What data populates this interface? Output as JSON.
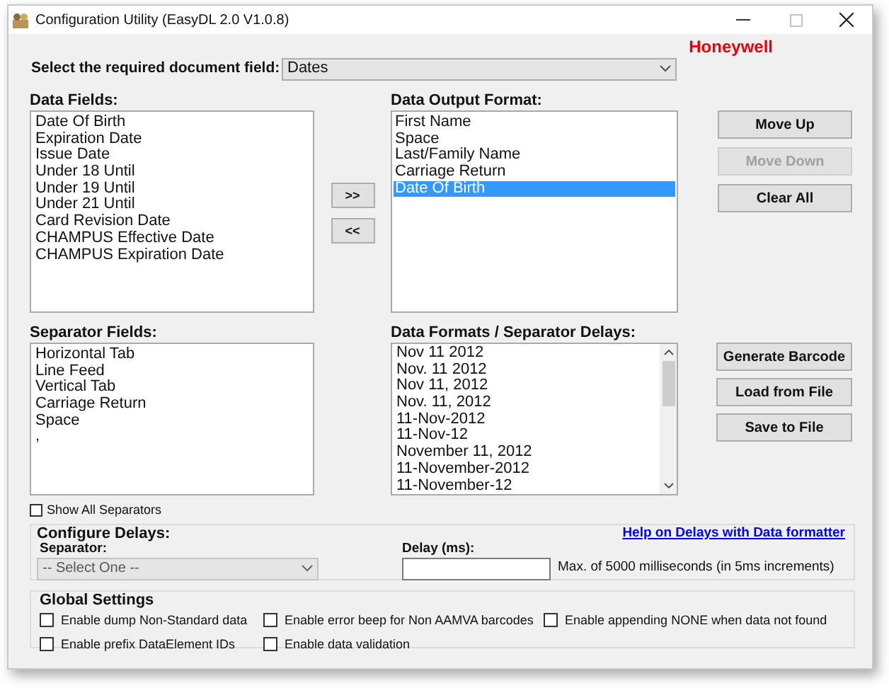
{
  "window": {
    "title": "Configuration Utility (EasyDL 2.0 V1.0.8)"
  },
  "brand": "Honeywell",
  "document_field": {
    "label": "Select the required document field:",
    "value": "Dates"
  },
  "data_fields": {
    "label": "Data Fields:",
    "items": [
      {
        "text": "Date Of Birth",
        "selected": false
      },
      {
        "text": "Expiration Date",
        "selected": false
      },
      {
        "text": "Issue Date",
        "selected": false
      },
      {
        "text": "Under 18 Until",
        "selected": false
      },
      {
        "text": "Under 19 Until",
        "selected": false
      },
      {
        "text": "Under 21 Until",
        "selected": false
      },
      {
        "text": "Card Revision Date",
        "selected": false
      },
      {
        "text": "CHAMPUS Effective Date",
        "selected": false
      },
      {
        "text": "CHAMPUS Expiration Date",
        "selected": false
      }
    ]
  },
  "transfer_buttons": [
    {
      "label": ">>"
    },
    {
      "label": "<<"
    }
  ],
  "data_output_format": {
    "label": "Data Output Format:",
    "items": [
      {
        "text": "First Name",
        "selected": false
      },
      {
        "text": "Space",
        "selected": false
      },
      {
        "text": "Last/Family Name",
        "selected": false
      },
      {
        "text": "Carriage Return",
        "selected": false
      },
      {
        "text": "Date Of Birth",
        "selected": true
      }
    ]
  },
  "order_buttons": [
    {
      "label": "Move Up",
      "disabled": false
    },
    {
      "label": "Move Down",
      "disabled": true
    },
    {
      "label": "Clear All",
      "disabled": false
    }
  ],
  "separator_fields": {
    "label": "Separator Fields:",
    "items": [
      {
        "text": "Horizontal Tab",
        "selected": false
      },
      {
        "text": "Line Feed",
        "selected": false
      },
      {
        "text": "Vertical Tab",
        "selected": false
      },
      {
        "text": "Carriage Return",
        "selected": false
      },
      {
        "text": "Space",
        "selected": false
      },
      {
        "text": ",",
        "selected": false
      }
    ]
  },
  "data_formats": {
    "label": "Data Formats / Separator Delays:",
    "items": [
      {
        "text": "Nov 11 2012",
        "selected": false
      },
      {
        "text": "Nov. 11 2012",
        "selected": false
      },
      {
        "text": "Nov 11, 2012",
        "selected": false
      },
      {
        "text": "Nov. 11, 2012",
        "selected": false
      },
      {
        "text": "11-Nov-2012",
        "selected": false
      },
      {
        "text": "11-Nov-12",
        "selected": false
      },
      {
        "text": "November 11, 2012",
        "selected": false
      },
      {
        "text": "11-November-2012",
        "selected": false
      },
      {
        "text": "11-November-12",
        "selected": false
      }
    ]
  },
  "file_buttons": [
    {
      "label": "Generate Barcode"
    },
    {
      "label": "Load from File"
    },
    {
      "label": "Save to File"
    }
  ],
  "show_all_separators": {
    "label": "Show All Separators",
    "checked": false
  },
  "configure_delays": {
    "title": "Configure Delays:",
    "help_link": "Help on Delays with Data formatter",
    "separator_label": "Separator:",
    "separator_value": "-- Select One --",
    "delay_label": "Delay (ms):",
    "hint": "Max. of 5000 milliseconds (in 5ms increments)"
  },
  "global_settings": {
    "title": "Global Settings",
    "options": [
      {
        "label": "Enable dump Non-Standard data",
        "checked": false
      },
      {
        "label": "Enable error beep for Non AAMVA barcodes",
        "checked": false
      },
      {
        "label": "Enable appending NONE when data not found",
        "checked": false
      },
      {
        "label": "Enable prefix DataElement IDs",
        "checked": false
      },
      {
        "label": "Enable data validation",
        "checked": false
      }
    ]
  }
}
